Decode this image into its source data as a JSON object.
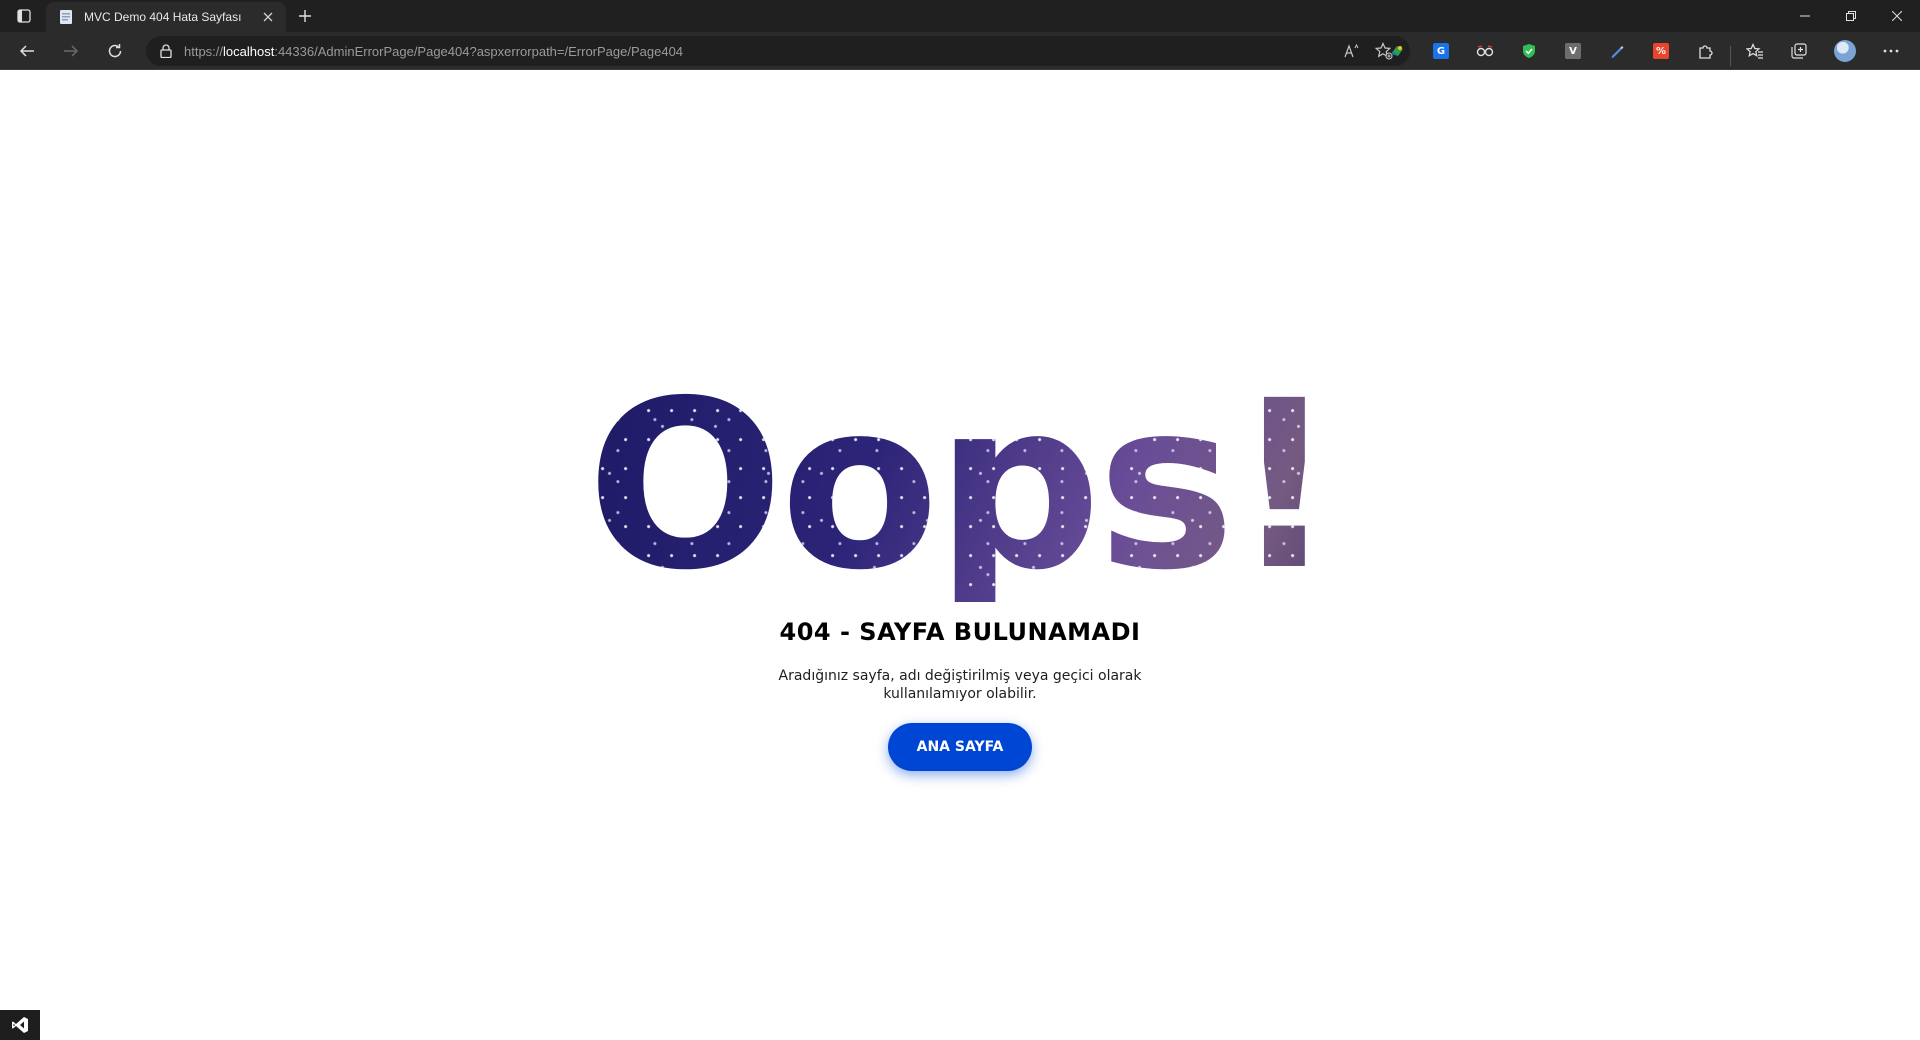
{
  "browser": {
    "tab": {
      "title": "MVC Demo 404 Hata Sayfası"
    },
    "address": {
      "scheme": "https://",
      "host": "localhost",
      "rest": ":44336/AdminErrorPage/Page404?aspxerrorpath=/ErrorPage/Page404"
    },
    "icons": {
      "tab_actions": "tab-actions-icon",
      "new_tab": "plus-icon",
      "back": "arrow-left-icon",
      "forward": "arrow-right-icon",
      "refresh": "refresh-icon",
      "lock": "lock-icon",
      "read_aloud": "read-aloud-icon",
      "favorite": "star-add-icon",
      "extensions": [
        "extension-green-icon",
        "translate-icon",
        "glasses-extension-icon",
        "shield-extension-icon",
        "v-extension-icon",
        "pen-extension-icon",
        "red-extension-icon",
        "puzzle-icon"
      ],
      "favorites": "favorites-icon",
      "collections": "collections-icon",
      "profile": "profile-avatar",
      "menu": "more-icon"
    }
  },
  "page": {
    "hero": "Oops!",
    "heading": "404 - SAYFA BULUNAMADI",
    "description_line1": "Aradığınız sayfa, adı değiştirilmiş veya geçici olarak",
    "description_line2": "kullanılamıyor olabilir.",
    "button_label": "ANA SAYFA"
  },
  "colors": {
    "button": "#0046d5",
    "hero_fill": "#1a1860",
    "titlebar": "#202020",
    "navbar": "#2b2b2b"
  }
}
